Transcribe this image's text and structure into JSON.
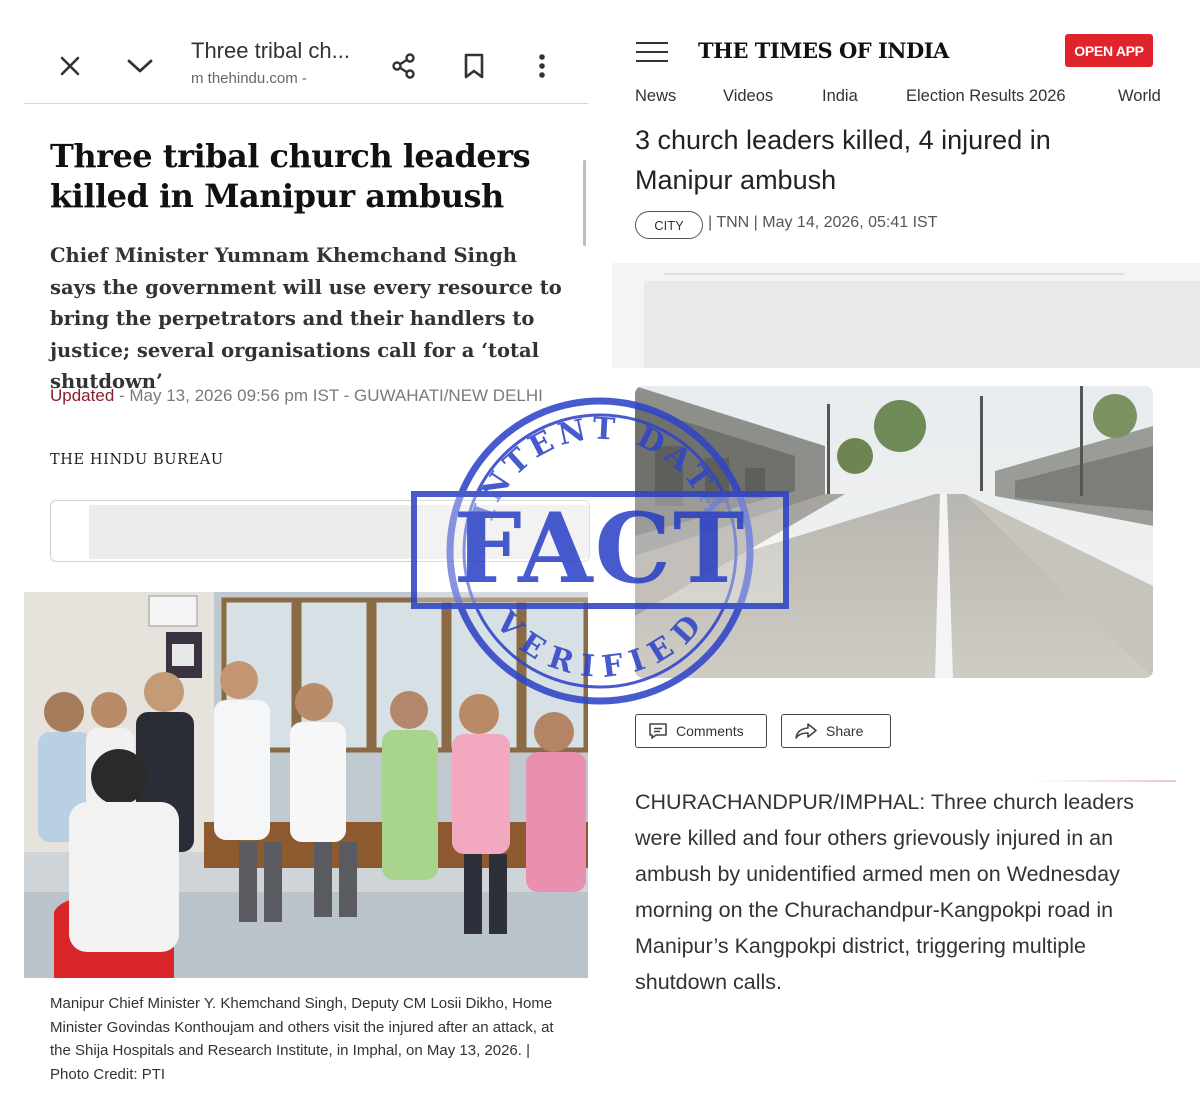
{
  "hindu": {
    "browser": {
      "tab_title": "Three tribal ch...",
      "url": "m thehindu.com -"
    },
    "headline": "Three tribal church leaders killed in Manipur ambush",
    "summary": "Chief Minister Yumnam Khemchand Singh says the government will use every resource to bring the perpetrators and their handlers to justice; several organisations call for a ‘total shutdown’",
    "updated_label": "Updated",
    "updated_text": " - May 13, 2026 09:56 pm IST - GUWAHATI/NEW DELHI",
    "byline": "THE HINDU BUREAU",
    "photo_caption": "Manipur Chief Minister Y. Khemchand Singh, Deputy CM Losii Dikho, Home Minister Govindas Konthoujam and others visit the injured after an attack, at the Shija Hospitals and Research Institute, in Imphal, on May 13, 2026. | Photo Credit: PTI"
  },
  "toi": {
    "logo": "THE TIMES OF INDIA",
    "open_app": "OPEN APP",
    "nav": [
      "News",
      "Videos",
      "India",
      "Election Results 2026",
      "World"
    ],
    "headline": "3 church leaders killed, 4 injured in Manipur ambush",
    "tag": "CITY",
    "byline": "| TNN | May 14, 2026, 05:41 IST",
    "comments_label": "Comments",
    "share_label": "Share",
    "body": "CHURACHANDPUR/IMPHAL: Three church leaders were killed and four others grievously injured in an ambush by unidentified armed men on Wednesday morning on the Churachandpur-Kangpokpi road in Manipur’s Kangpokpi district, triggering multiple shutdown calls."
  },
  "stamp": {
    "top_text": "INTENT DATA",
    "main_text": "FACT",
    "bottom_text": "VERIFIED",
    "color": "#2f45c8"
  },
  "icons": {
    "close": "close-icon",
    "chevron": "chevron-down-icon",
    "share": "share-icon",
    "bookmark": "bookmark-icon",
    "more": "more-vert-icon",
    "menu": "hamburger-menu-icon",
    "comments": "comment-icon",
    "share_arrow": "share-arrow-icon"
  },
  "colors": {
    "hindu_updated": "#8a1c2c",
    "toi_red": "#e0242b"
  }
}
